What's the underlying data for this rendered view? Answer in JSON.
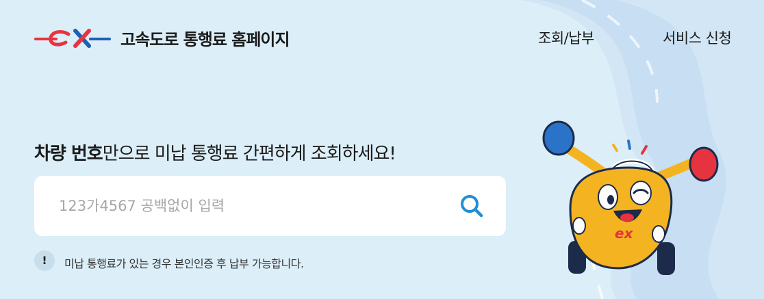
{
  "header": {
    "site_title": "고속도로 통행료 홈페이지",
    "logo_text": "ex",
    "nav": [
      {
        "label": "조회/납부"
      },
      {
        "label": "서비스 신청"
      }
    ]
  },
  "main": {
    "headline_bold": "차량 번호",
    "headline_rest": "만으로 미납 통행료 간편하게 조회하세요!",
    "search": {
      "placeholder": "123가4567 공백없이 입력",
      "value": "",
      "icon": "search-icon"
    },
    "notice": {
      "icon_glyph": "!",
      "text": "미납 통행료가 있는 경우 본인인증 후 납부 가능합니다."
    },
    "mascot": {
      "logo_text": "ex"
    }
  },
  "colors": {
    "background": "#dceef7",
    "road": "#c9e0f2",
    "brand_red": "#e8343f",
    "brand_blue": "#1f5fb5",
    "search_icon": "#1f8fd6",
    "mascot_yellow": "#f4b321"
  }
}
